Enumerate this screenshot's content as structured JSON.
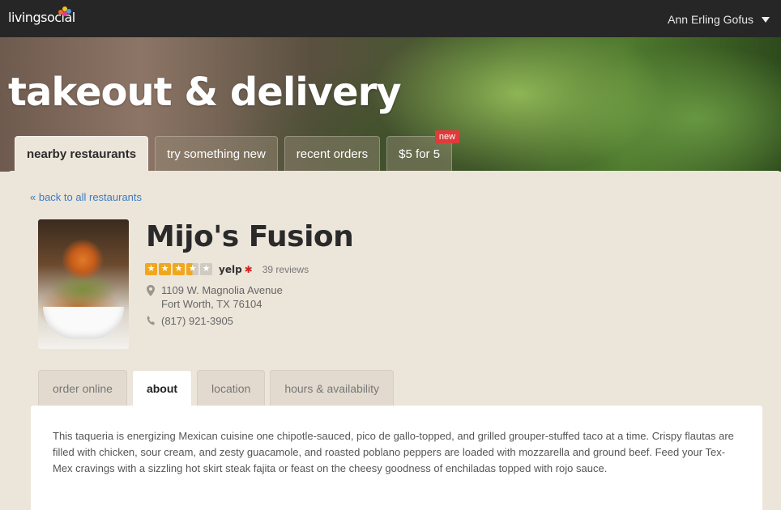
{
  "brand": {
    "logo_text": "livingsocial"
  },
  "user": {
    "name": "Ann Erling Gofus"
  },
  "hero": {
    "title": "takeout & delivery"
  },
  "main_tabs": [
    {
      "label": "nearby restaurants",
      "active": true
    },
    {
      "label": "try something new",
      "active": false
    },
    {
      "label": "recent orders",
      "active": false
    },
    {
      "label": "$5 for 5",
      "active": false,
      "badge": "new"
    }
  ],
  "back_link": "« back to all restaurants",
  "restaurant": {
    "name": "Mijo's Fusion",
    "rating": 3.5,
    "rating_max": 5,
    "rating_source": "yelp",
    "review_count": "39 reviews",
    "address_line1": "1109 W. Magnolia Avenue",
    "address_line2": "Fort Worth, TX 76104",
    "phone": "(817) 921-3905"
  },
  "sub_tabs": [
    {
      "label": "order online",
      "active": false
    },
    {
      "label": "about",
      "active": true
    },
    {
      "label": "location",
      "active": false
    },
    {
      "label": "hours & availability",
      "active": false
    }
  ],
  "about": {
    "text": "This taqueria is energizing Mexican cuisine one chipotle-sauced, pico de gallo-topped, and grilled grouper-stuffed taco at a time. Crispy flautas are filled with chicken, sour cream, and zesty guacamole, and roasted poblano peppers are loaded with mozzarella and ground beef. Feed your Tex-Mex cravings with a sizzling hot skirt steak fajita or feast on the cheesy goodness of enchiladas topped with rojo sauce."
  },
  "colors": {
    "topbar": "#262626",
    "link": "#3b7bbf",
    "star": "#f1a71d",
    "badge": "#e03b3b",
    "yelp_red": "#d32323"
  }
}
